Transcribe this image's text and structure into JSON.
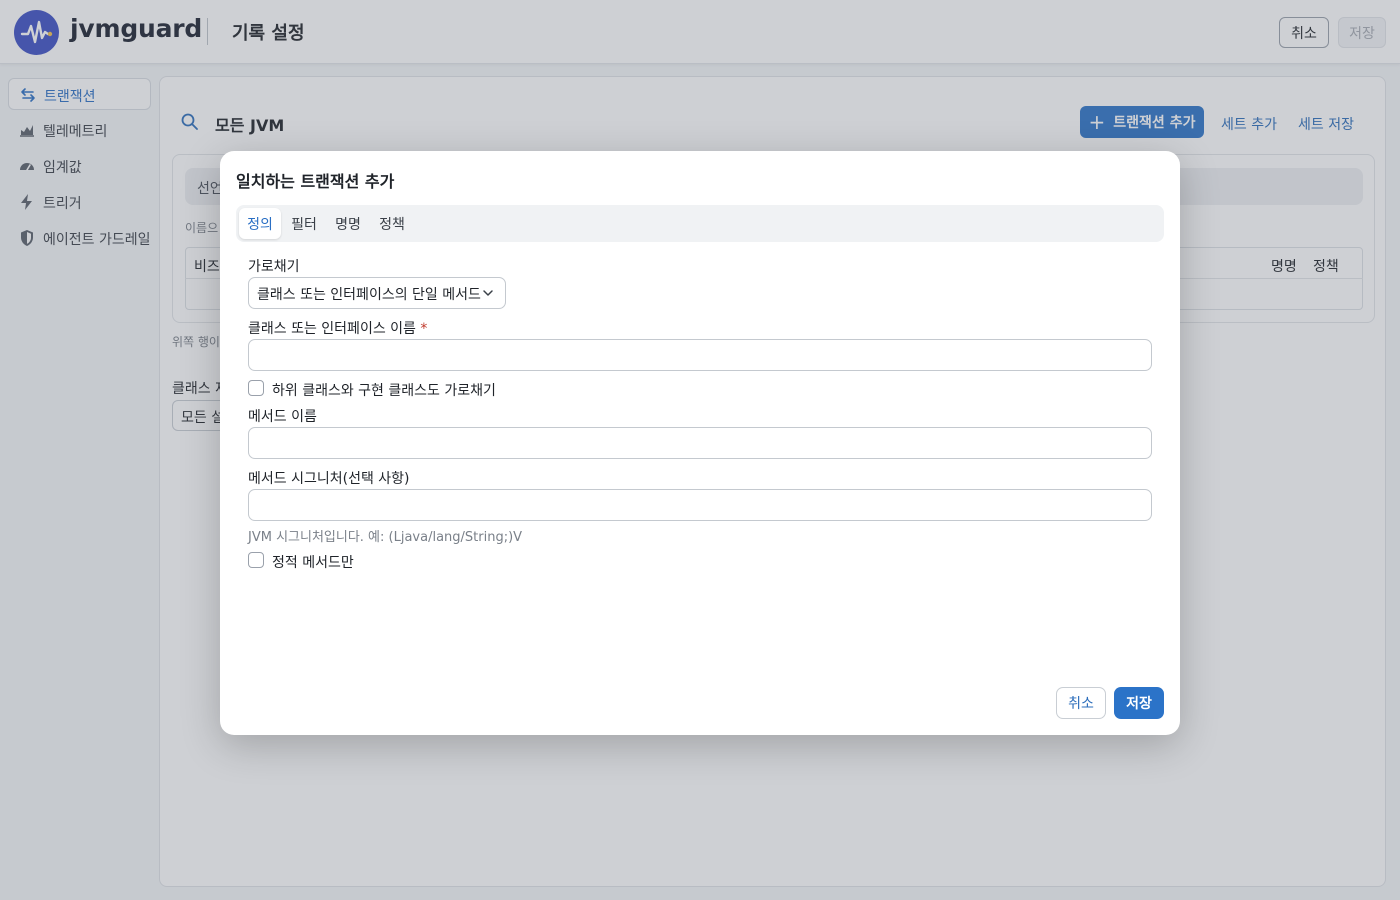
{
  "header": {
    "brand": "jvmguard",
    "title": "기록 설정",
    "cancel_label": "취소",
    "save_label": "저장",
    "logo_color": "#3d4fc4"
  },
  "sidebar": {
    "items": [
      {
        "label": "트랜잭션",
        "icon": "transaction-icon",
        "active": true
      },
      {
        "label": "텔레메트리",
        "icon": "chart-icon",
        "active": false
      },
      {
        "label": "임계값",
        "icon": "gauge-icon",
        "active": false
      },
      {
        "label": "트리거",
        "icon": "lightning-icon",
        "active": false
      },
      {
        "label": "에이전트 가드레일",
        "icon": "shield-icon",
        "active": false
      }
    ]
  },
  "main": {
    "scope_label": "모든 JVM",
    "add_transaction_label": "트랜잭션 추가",
    "add_set_label": "세트 추가",
    "save_set_label": "세트 저장",
    "segment_text": "선언",
    "hint_text": "이름으",
    "table_col_first": "비즈",
    "table_col_naming": "명명",
    "table_col_policy": "정책",
    "note_text": "위쪽 행이 모",
    "class_section_label": "클래스 재",
    "class_select_value": "모든 설"
  },
  "modal": {
    "title": "일치하는 트랜잭션 추가",
    "tabs": [
      {
        "label": "정의",
        "active": true
      },
      {
        "label": "필터",
        "active": false
      },
      {
        "label": "명명",
        "active": false
      },
      {
        "label": "정책",
        "active": false
      }
    ],
    "interceptor_label": "가로채기",
    "interceptor_value": "클래스 또는 인터페이스의 단일 메서드",
    "class_name_label": "클래스 또는 인터페이스 이름",
    "required_mark": "*",
    "class_name_value": "",
    "subclass_check_label": "하위 클래스와 구현 클래스도 가로채기",
    "subclass_checked": false,
    "method_name_label": "메서드 이름",
    "method_name_value": "",
    "signature_label": "메서드 시그니처(선택 사항)",
    "signature_value": "",
    "signature_help": "JVM 시그니처입니다. 예: (Ljava/lang/String;)V",
    "static_check_label": "정적 메서드만",
    "static_checked": false,
    "cancel_label": "취소",
    "save_label": "저장",
    "accent_color": "#2b73c8"
  }
}
